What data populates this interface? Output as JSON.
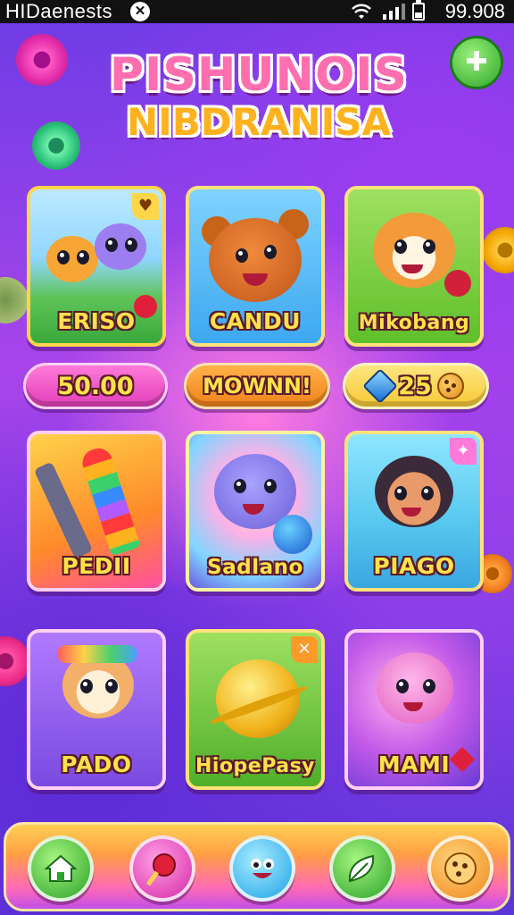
{
  "status_bar": {
    "title": "HIDaenests",
    "value": "99.908",
    "left_icon": "circle-badge-icon",
    "icons": [
      "wifi-icon",
      "signal-icon",
      "battery-icon"
    ]
  },
  "header": {
    "title_line_1": "PISHUNOIS",
    "title_line_2": "NIBDRANISA",
    "close_icon": "close-icon"
  },
  "cards_row_1": [
    {
      "label": "ERISO",
      "icon": "kittens-icon"
    },
    {
      "label": "CANDU",
      "icon": "bear-icon"
    },
    {
      "label": "Mikobang",
      "icon": "hamster-icon"
    }
  ],
  "currency": {
    "coins": "50.00",
    "mode": "MOWNN!",
    "gems": "25",
    "gem_icon": "gem-icon",
    "cookie_icon": "cookie-icon"
  },
  "cards_row_2": [
    {
      "label": "PEDII",
      "icon": "rocket-icon"
    },
    {
      "label": "Sadlano",
      "icon": "blue-cat-icon"
    },
    {
      "label": "PIAGO",
      "icon": "kitten-girl-icon"
    }
  ],
  "cards_row_3": [
    {
      "label": "PADO",
      "icon": "artist-cat-icon"
    },
    {
      "label": "HiopePasy",
      "icon": "golden-planet-icon"
    },
    {
      "label": "MAMI",
      "icon": "pink-cat-icon"
    }
  ],
  "bottom_nav": [
    {
      "icon": "home-icon"
    },
    {
      "icon": "candy-icon"
    },
    {
      "icon": "smiley-icon"
    },
    {
      "icon": "leaf-icon"
    },
    {
      "icon": "cookie-icon"
    }
  ],
  "colors": {
    "accent_yellow": "#ffe14a",
    "background_purple": "#8a3ee8",
    "pink": "#ff6fb0"
  }
}
